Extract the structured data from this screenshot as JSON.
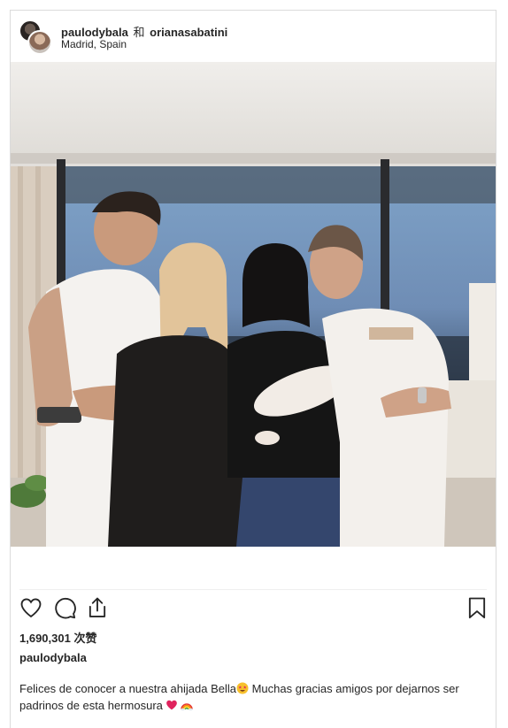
{
  "post": {
    "user1": "paulodybala",
    "separator": "和",
    "user2": "orianasabatini",
    "location": "Madrid, Spain",
    "likes_count": "1,690,301",
    "likes_label": "次赞",
    "author": "paulodybala",
    "caption_part1": "Felices de conocer a nuestra ahijada Bella",
    "caption_part2": " Muchas gracias amigos por dejarnos ser padrinos de esta hermosura "
  },
  "icons": {
    "like": "heart-outline-icon",
    "comment": "comment-bubble-icon",
    "share": "share-upload-icon",
    "save": "bookmark-icon",
    "caption_emoji_1": "star-struck-emoji-icon",
    "caption_emoji_2": "red-heart-emoji-icon",
    "caption_emoji_3": "rainbow-emoji-icon"
  },
  "colors": {
    "text": "#262626",
    "border": "#dbdbdb",
    "heart_red": "#e0245e"
  }
}
